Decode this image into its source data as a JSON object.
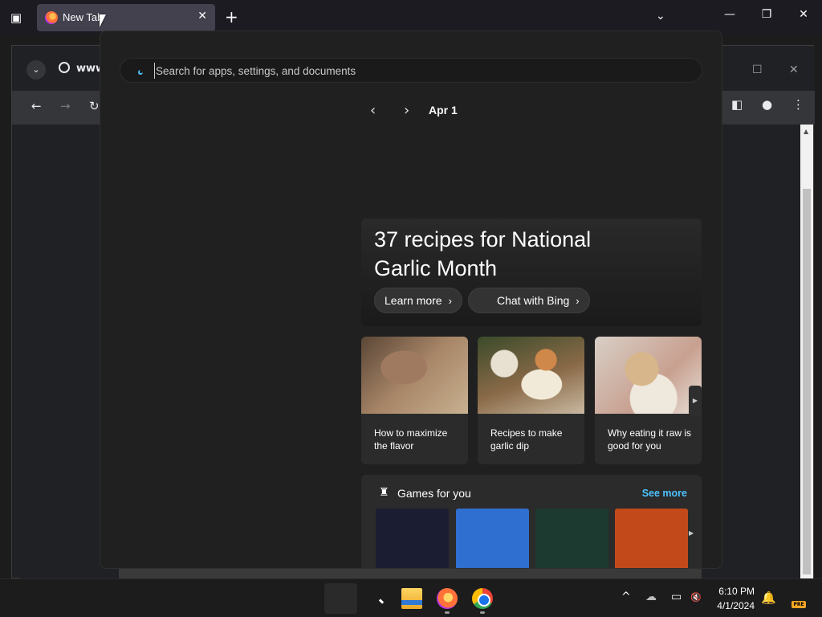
{
  "firefox": {
    "tab_title": "New Tab",
    "listall_icon": "list-all-tabs-icon",
    "close_glyph": "✕",
    "newtab_glyph": "+",
    "chevron_glyph": "⌄",
    "minimize_glyph": "—",
    "restore_glyph": "❐",
    "closewin_glyph": "✕"
  },
  "chrome": {
    "site_text": "www",
    "back_glyph": "←",
    "forward_glyph": "→",
    "reload_glyph": "↻",
    "sidebar_glyph": "◧",
    "profile_glyph": "●",
    "menu_glyph": "⋮",
    "maximize_glyph": "☐",
    "close_glyph": "✕",
    "tabsearch_glyph": "⌄",
    "scroll_up_glyph": "▲"
  },
  "panel": {
    "search_placeholder": "Search for apps, settings, and documents",
    "prev_glyph": "‹",
    "next_glyph": "›",
    "date": "Apr 1",
    "hero": {
      "title": "37 recipes for National Garlic Month",
      "learn_more": "Learn more",
      "chat_bing": "Chat with Bing",
      "chev": "›"
    },
    "cards": [
      {
        "caption": "How to maximize the flavor"
      },
      {
        "caption": "Recipes to make garlic dip"
      },
      {
        "caption": "Why eating it raw is good for you"
      }
    ],
    "carousel_next_glyph": "▶",
    "games": {
      "title": "Games for you",
      "see_more": "See more",
      "icon_glyph": "♜",
      "next_glyph": "▶",
      "tile_colors": [
        "#1b1d33",
        "#2f6fd0",
        "#1c3a30",
        "#c24a1a"
      ]
    }
  },
  "taskbar": {
    "tray_up_glyph": "^",
    "cloud_glyph": "☁",
    "display_glyph": "▭",
    "volume_glyph": "🔇",
    "time": "6:10 PM",
    "date": "4/1/2024",
    "bell_glyph": "🔔",
    "pre_badge": "PRE"
  }
}
